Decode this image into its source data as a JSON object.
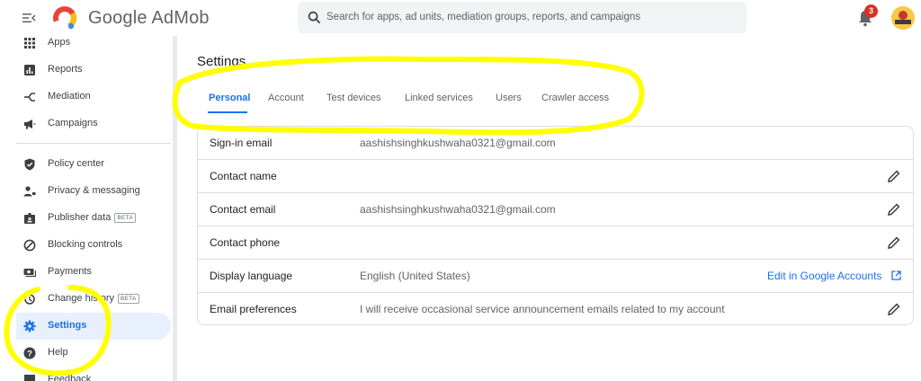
{
  "header": {
    "app_name": "Google AdMob",
    "search_placeholder": "Search for apps, ad units, mediation groups, reports, and campaigns",
    "notification_count": "3",
    "icons": [
      "menu-toggle-icon",
      "admob-logo",
      "search-icon",
      "bell-icon",
      "avatar"
    ]
  },
  "sidebar": {
    "items": [
      {
        "label": "Apps",
        "icon": "apps-grid-icon"
      },
      {
        "label": "Reports",
        "icon": "reports-chart-icon"
      },
      {
        "label": "Mediation",
        "icon": "mediation-icon"
      },
      {
        "label": "Campaigns",
        "icon": "megaphone-icon"
      },
      {
        "label": "Policy center",
        "icon": "shield-icon"
      },
      {
        "label": "Privacy & messaging",
        "icon": "person-lock-icon"
      },
      {
        "label": "Publisher data",
        "icon": "badge-icon",
        "badge": "BETA"
      },
      {
        "label": "Blocking controls",
        "icon": "block-icon"
      },
      {
        "label": "Payments",
        "icon": "payments-icon"
      },
      {
        "label": "Change history",
        "icon": "history-icon",
        "badge": "BETA"
      },
      {
        "label": "Settings",
        "icon": "gear-icon",
        "active": true
      },
      {
        "label": "Help",
        "icon": "help-icon"
      },
      {
        "label": "Feedback",
        "icon": "feedback-icon"
      }
    ]
  },
  "main": {
    "title": "Settings",
    "tabs": [
      {
        "label": "Personal",
        "active": true
      },
      {
        "label": "Account"
      },
      {
        "label": "Test devices"
      },
      {
        "label": "Linked services"
      },
      {
        "label": "Users"
      },
      {
        "label": "Crawler access"
      }
    ],
    "rows": [
      {
        "key": "Sign-in email",
        "value": "aashishsinghkushwaha0321@gmail.com",
        "editable": false
      },
      {
        "key": "Contact name",
        "value": "",
        "editable": true
      },
      {
        "key": "Contact email",
        "value": "aashishsinghkushwaha0321@gmail.com",
        "editable": true
      },
      {
        "key": "Contact phone",
        "value": "",
        "editable": true
      },
      {
        "key": "Display language",
        "value": "English (United States)",
        "link": "Edit in Google Accounts"
      },
      {
        "key": "Email preferences",
        "value": "I will receive occasional service announcement emails related to my account",
        "editable": true
      }
    ]
  },
  "colors": {
    "accent": "#1a73e8",
    "active_bg": "#e8f0fe",
    "highlight": "#ffff00",
    "badge": "#d93025"
  }
}
